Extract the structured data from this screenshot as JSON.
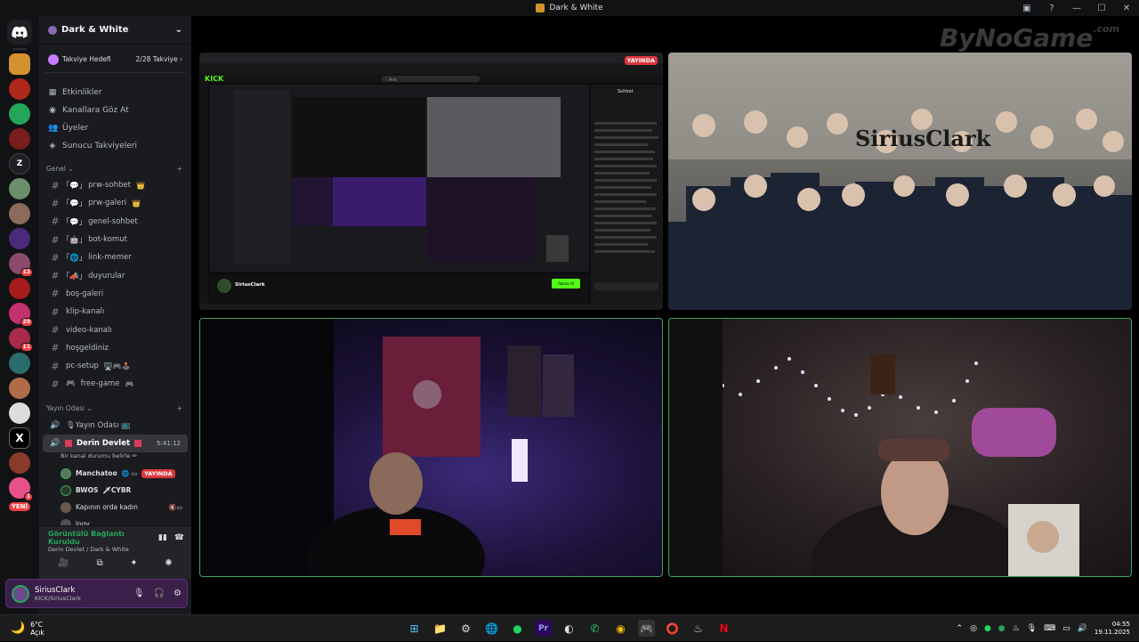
{
  "window": {
    "title": "Dark & White",
    "buttons": [
      "▣",
      "?",
      "—",
      "☐",
      "✕"
    ]
  },
  "rail": {
    "servers": [
      {
        "name": "discord-home",
        "color": "#5865f2",
        "glyph": ""
      },
      {
        "name": "server-dark-white",
        "color": "#d4922e",
        "glyph": ""
      },
      {
        "name": "server-red",
        "color": "#b0271c",
        "glyph": ""
      },
      {
        "name": "server-green",
        "color": "#23a55a",
        "glyph": ""
      },
      {
        "name": "server-red-1",
        "color": "#7a1d1d",
        "glyph": ""
      },
      {
        "name": "server-z",
        "color": "#1e1f22",
        "glyph": "Z"
      },
      {
        "name": "server-img1",
        "color": "#6b8e6b",
        "glyph": ""
      },
      {
        "name": "server-img2",
        "color": "#8a6b5c",
        "glyph": ""
      },
      {
        "name": "server-purple",
        "color": "#4c2a7a",
        "glyph": ""
      },
      {
        "name": "server-img3",
        "color": "#8a4a6b",
        "glyph": "",
        "badge": "13"
      },
      {
        "name": "server-bulls",
        "color": "#a61c1c",
        "glyph": ""
      },
      {
        "name": "server-img4",
        "color": "#c4316f",
        "glyph": "",
        "badge": "29"
      },
      {
        "name": "server-img5",
        "color": "#a82a4a",
        "glyph": "",
        "badge": "11"
      },
      {
        "name": "server-img6",
        "color": "#2a6b6b",
        "glyph": ""
      },
      {
        "name": "server-img7",
        "color": "#b06b4a",
        "glyph": ""
      },
      {
        "name": "server-img8",
        "color": "#dcdcdc",
        "glyph": ""
      },
      {
        "name": "server-x",
        "color": "#000000",
        "glyph": "X"
      },
      {
        "name": "server-img9",
        "color": "#8a3a2a",
        "glyph": ""
      },
      {
        "name": "server-pink",
        "color": "#e8508a",
        "glyph": "",
        "badge": "1"
      }
    ],
    "new_label": "YENİ"
  },
  "sidebar": {
    "server_name": "Dark & White",
    "boost": {
      "label": "Takviye Hedefi",
      "progress": "2/28 Takviye"
    },
    "menu": [
      {
        "icon": "▦",
        "label": "Etkinlikler"
      },
      {
        "icon": "◉",
        "label": "Kanallara Göz At"
      },
      {
        "icon": "👥",
        "label": "Üyeler"
      },
      {
        "icon": "◈",
        "label": "Sunucu Takviyeleri"
      }
    ],
    "category_general": "Genel",
    "text_channels": [
      {
        "prefix": "｢💬｣",
        "name": "prw-sohbet",
        "suffix": "👑"
      },
      {
        "prefix": "｢💬｣",
        "name": "prw-galeri",
        "suffix": "👑"
      },
      {
        "prefix": "｢💬｣",
        "name": "genel-sohbet",
        "suffix": ""
      },
      {
        "prefix": "｢🤖｣",
        "name": "bot-komut",
        "suffix": ""
      },
      {
        "prefix": "｢🌐｣",
        "name": "link-memer",
        "suffix": ""
      },
      {
        "prefix": "｢📣｣",
        "name": "duyurular",
        "suffix": ""
      },
      {
        "prefix": "",
        "name": "boş-galeri",
        "suffix": ""
      },
      {
        "prefix": "",
        "name": "klip-kanalı",
        "suffix": ""
      },
      {
        "prefix": "",
        "name": "video-kanalı",
        "suffix": ""
      },
      {
        "prefix": "",
        "name": "hoşgeldiniz",
        "suffix": ""
      },
      {
        "prefix": "",
        "name": "pc-setup",
        "suffix": "🖥️🎮🕹️"
      },
      {
        "prefix": "🎮",
        "name": "free-game",
        "suffix": "🎮"
      }
    ],
    "category_voice": "Yayın Odası",
    "voice_channels": [
      {
        "name": "🎙Yayın Odası 📺",
        "active": false
      },
      {
        "name": "Derin Devlet",
        "active": true,
        "time": "5:41:12"
      }
    ],
    "status_text": "Bir kanal durumu belirle ✏",
    "voice_users": [
      {
        "name": "Manchatoo",
        "live": "YAYINDA"
      },
      {
        "name": "BWOS",
        "extra": "🗡CYBR"
      },
      {
        "name": "Kapının orda kadın",
        "extra": ""
      },
      {
        "name": "logy",
        "extra": ""
      }
    ]
  },
  "voice_panel": {
    "connected": "Görüntülü Bağlantı Kuruldu",
    "channel": "Derin Devlet / Dark & White",
    "buttons": [
      "🎥",
      "⧉",
      "✦",
      "✺"
    ]
  },
  "user_panel": {
    "name": "SiriusClark",
    "status": "KICK/SiriusClark"
  },
  "stage": {
    "watermark": "ByNoGame",
    "watermark_suffix": ".com",
    "live_label": "YAYINDA",
    "stream_overlay_text": "SiriusClark",
    "kick_logo": "KICK",
    "kick_search": "Ara",
    "chat_title": "Sohbet",
    "follow_button": "Abone Ol",
    "kick_streamer": "SiriusClark"
  },
  "taskbar": {
    "temp": "6°C",
    "weather": "Açık",
    "time": "04:55",
    "date": "19.11.2025",
    "apps": [
      "⊞",
      "📁",
      "⚙",
      "🌐",
      "●",
      "Pr",
      "◐",
      "✆",
      "◉",
      "🎮",
      "⭕",
      "♨",
      "N"
    ]
  }
}
